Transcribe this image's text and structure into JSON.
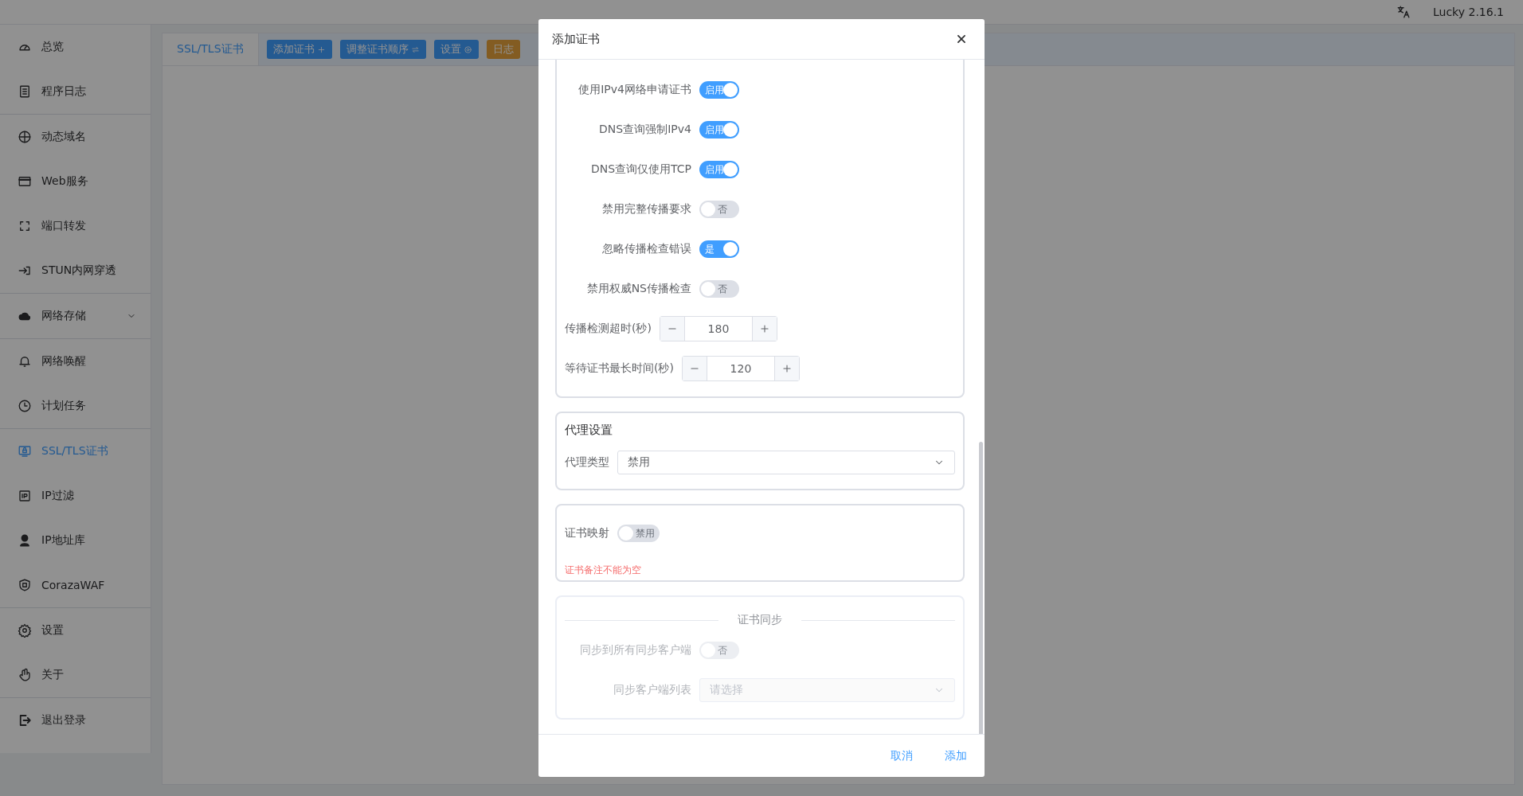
{
  "top_bar": {
    "version": "Lucky 2.16.1"
  },
  "sidebar": {
    "groups": [
      [
        {
          "label": "总览",
          "selected": false,
          "has_submenu": false
        },
        {
          "label": "程序日志",
          "selected": false,
          "has_submenu": false
        }
      ],
      [
        {
          "label": "动态域名",
          "selected": false,
          "has_submenu": false
        },
        {
          "label": "Web服务",
          "selected": false,
          "has_submenu": false
        },
        {
          "label": "端口转发",
          "selected": false,
          "has_submenu": false
        },
        {
          "label": "STUN内网穿透",
          "selected": false,
          "has_submenu": false
        }
      ],
      [
        {
          "label": "网络存储",
          "selected": false,
          "has_submenu": true
        }
      ],
      [
        {
          "label": "网络唤醒",
          "selected": false,
          "has_submenu": false
        },
        {
          "label": "计划任务",
          "selected": false,
          "has_submenu": false
        }
      ],
      [
        {
          "label": "SSL/TLS证书",
          "selected": true,
          "has_submenu": false
        },
        {
          "label": "IP过滤",
          "selected": false,
          "has_submenu": false
        },
        {
          "label": "IP地址库",
          "selected": false,
          "has_submenu": false
        },
        {
          "label": "CorazaWAF",
          "selected": false,
          "has_submenu": false
        }
      ],
      [
        {
          "label": "设置",
          "selected": false,
          "has_submenu": false
        },
        {
          "label": "关于",
          "selected": false,
          "has_submenu": false
        }
      ],
      [
        {
          "label": "退出登录",
          "selected": false,
          "has_submenu": false
        }
      ]
    ]
  },
  "tabs": [
    {
      "label": "SSL/TLS证书",
      "selected": true
    }
  ],
  "toolbar": [
    {
      "label": "添加证书",
      "kind": "primary"
    },
    {
      "label": "调整证书顺序",
      "kind": "primary"
    },
    {
      "label": "设置",
      "kind": "primary"
    },
    {
      "label": "日志",
      "kind": "warning"
    }
  ],
  "dialog": {
    "title": "添加证书",
    "sections": [
      {
        "kind": "plain",
        "disabled": false,
        "rows": [
          {
            "kind": "toggle",
            "label": "使用IPv4网络申请证书",
            "on": true,
            "state_text": "启用"
          },
          {
            "kind": "toggle",
            "label": "DNS查询强制IPv4",
            "on": true,
            "state_text": "启用"
          },
          {
            "kind": "toggle",
            "label": "DNS查询仅使用TCP",
            "on": true,
            "state_text": "启用"
          },
          {
            "kind": "toggle",
            "label": "禁用完整传播要求",
            "on": false,
            "state_text": "否"
          },
          {
            "kind": "toggle",
            "label": "忽略传播检查错误",
            "on": true,
            "state_text": "是"
          },
          {
            "kind": "toggle",
            "label": "禁用权威NS传播检查",
            "on": false,
            "state_text": "否"
          },
          {
            "kind": "number",
            "label": "传播检测超时(秒)",
            "value": "180"
          },
          {
            "kind": "number",
            "label": "等待证书最长时间(秒)",
            "value": "120"
          }
        ]
      },
      {
        "kind": "titled",
        "title": "代理设置",
        "disabled": false,
        "rows": [
          {
            "kind": "select",
            "label": "代理类型",
            "value": "禁用"
          }
        ]
      },
      {
        "kind": "inline",
        "disabled": false,
        "rows": [
          {
            "kind": "toggle",
            "label": "证书映射",
            "on": false,
            "state_text": "禁用"
          },
          {
            "kind": "error",
            "text": "证书备注不能为空"
          }
        ]
      },
      {
        "kind": "divided",
        "title": "证书同步",
        "disabled": true,
        "rows": [
          {
            "kind": "toggle",
            "label": "同步到所有同步客户端",
            "on": false,
            "state_text": "否"
          },
          {
            "kind": "select",
            "label": "同步客户端列表",
            "placeholder": "请选择"
          }
        ]
      }
    ],
    "buttons": [
      {
        "label": "取消"
      },
      {
        "label": "添加"
      }
    ]
  }
}
